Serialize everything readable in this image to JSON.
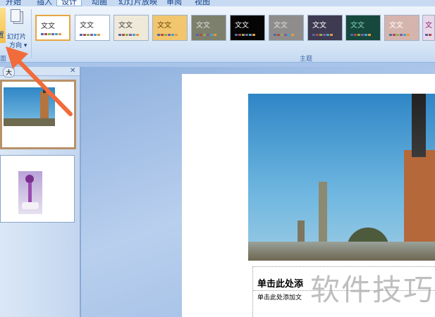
{
  "tabs": [
    "开始",
    "插入",
    "设计",
    "动画",
    "幻灯片放映",
    "审阅",
    "视图"
  ],
  "active_tab": "设计",
  "ribbon": {
    "page_setup_group": "面",
    "orientation_button": {
      "line1": "幻灯片",
      "line2": "方向 ▾"
    },
    "page_setup_btn_fragment": "置",
    "themes_group_label": "主题",
    "themes": [
      {
        "label": "文文",
        "bg": "#ffffff",
        "fg": "#333333"
      },
      {
        "label": "文文",
        "bg": "#ffffff",
        "fg": "#333333"
      },
      {
        "label": "文文",
        "bg": "#efe9da",
        "fg": "#444444"
      },
      {
        "label": "文文",
        "bg": "#f2c66e",
        "fg": "#6b4a10"
      },
      {
        "label": "文文",
        "bg": "#7d806c",
        "fg": "#dddddd"
      },
      {
        "label": "文文",
        "bg": "#050505",
        "fg": "#eeeeee"
      },
      {
        "label": "文文",
        "bg": "#8f8c8c",
        "fg": "#dddddd"
      },
      {
        "label": "文文",
        "bg": "#3e3a52",
        "fg": "#ffffff"
      },
      {
        "label": "文文",
        "bg": "#16483d",
        "fg": "#7fd0b4"
      },
      {
        "label": "文文",
        "bg": "#d6b4ae",
        "fg": "#ffffff"
      },
      {
        "label": "文",
        "bg": "#e8d8ea",
        "fg": "#8a2a7a"
      }
    ]
  },
  "pane": {
    "tab_label": "大",
    "close": "✕"
  },
  "slide": {
    "title_placeholder": "单击此处添",
    "subtitle_placeholder": "单击此处添加文"
  },
  "watermark": "软件技巧",
  "colors": {
    "arrow": "#f26b3a",
    "selected_border": "#b8916a"
  }
}
